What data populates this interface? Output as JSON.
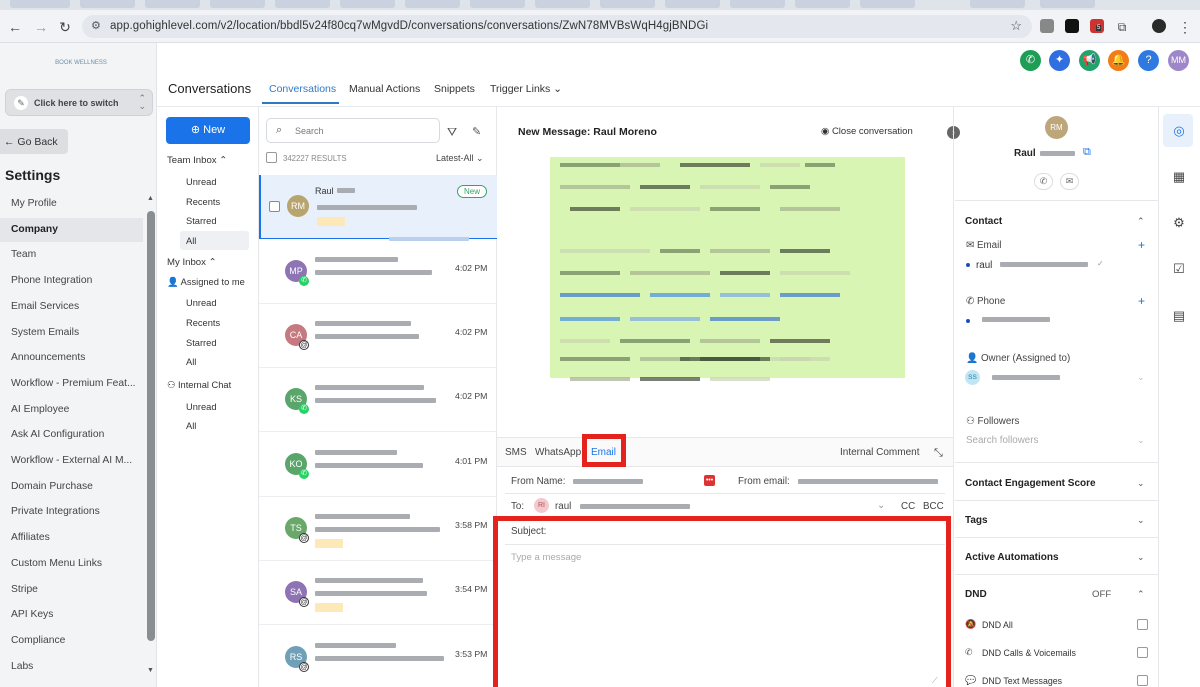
{
  "browser": {
    "url": "app.gohighlevel.com/v2/location/bbdl5v24f80cq7wMgvdD/conversations/conversations/ZwN78MVBsWqH4gjBNDGi",
    "ext_badge": "5"
  },
  "sidebar": {
    "logo_text": "BOOK WELLNESS",
    "switcher_label": "Click here to switch",
    "go_back": "← Go Back",
    "heading": "Settings",
    "items": [
      "My Profile",
      "Company",
      "Team",
      "Phone Integration",
      "Email Services",
      "System Emails",
      "Announcements",
      "Workflow - Premium Feat...",
      "AI Employee",
      "Ask AI Configuration",
      "Workflow - External AI M...",
      "Domain Purchase",
      "Private Integrations",
      "Affiliates",
      "Custom Menu Links",
      "Stripe",
      "API Keys",
      "Compliance",
      "Labs"
    ],
    "active_item": "Company"
  },
  "header": {
    "title": "Conversations",
    "tabs": [
      "Conversations",
      "Manual Actions",
      "Snippets",
      "Trigger Links"
    ],
    "avatar_initials": "MM",
    "help": "?"
  },
  "inbox": {
    "new_button": "New",
    "team_inbox": "Team Inbox",
    "team_items": [
      "Unread",
      "Recents",
      "Starred",
      "All"
    ],
    "my_inbox": "My Inbox",
    "assigned": "Assigned to me",
    "my_items": [
      "Unread",
      "Recents",
      "Starred",
      "All"
    ],
    "internal_chat": "Internal Chat",
    "chat_items": [
      "Unread",
      "All"
    ]
  },
  "conv_list": {
    "search_placeholder": "Search",
    "results": "342227 RESULTS",
    "sort": "Latest-All",
    "items": [
      {
        "initials": "RM",
        "name": "Raul",
        "time": "",
        "badge": "New",
        "color": "#b8a46e",
        "channel": ""
      },
      {
        "initials": "MP",
        "time": "4:02 PM",
        "color": "#8e74b3",
        "channel": "whatsapp"
      },
      {
        "initials": "CA",
        "time": "4:02 PM",
        "color": "#c47a80",
        "channel": "email"
      },
      {
        "initials": "KS",
        "time": "4:02 PM",
        "color": "#5aa66a",
        "channel": "whatsapp"
      },
      {
        "initials": "KO",
        "time": "4:01 PM",
        "color": "#5aa66a",
        "channel": "whatsapp"
      },
      {
        "initials": "TS",
        "time": "3:58 PM",
        "color": "#6aa86a",
        "channel": "email"
      },
      {
        "initials": "SA",
        "time": "3:54 PM",
        "color": "#8e74b3",
        "channel": "email"
      },
      {
        "initials": "RS",
        "time": "3:53 PM",
        "color": "#6fa0b8",
        "channel": "email"
      }
    ]
  },
  "message": {
    "header": "New Message: Raul Moreno",
    "close": "Close conversation",
    "tabs": [
      "SMS",
      "WhatsApp",
      "Email"
    ],
    "active_tab": "Email",
    "internal_comment": "Internal Comment",
    "from_name_label": "From Name:",
    "from_email_label": "From email:",
    "to_label": "To:",
    "to_initials": "RI",
    "to_value": "raul",
    "cc": "CC",
    "bcc": "BCC",
    "subject_label": "Subject:",
    "message_placeholder": "Type a message"
  },
  "contact": {
    "initials": "RM",
    "name": "Raul",
    "section_contact": "Contact",
    "email_label": "Email",
    "email_value": "raul",
    "phone_label": "Phone",
    "owner_label": "Owner (Assigned to)",
    "owner_initials": "SS",
    "followers_label": "Followers",
    "followers_placeholder": "Search followers",
    "engagement": "Contact Engagement Score",
    "tags": "Tags",
    "automations": "Active Automations",
    "dnd": "DND",
    "dnd_state": "OFF",
    "dnd_items": [
      "DND All",
      "DND Calls & Voicemails",
      "DND Text Messages"
    ]
  },
  "colors": {
    "accent": "#1a73e8",
    "highlight": "#e3231c",
    "email_body": "#d9f5b3"
  }
}
